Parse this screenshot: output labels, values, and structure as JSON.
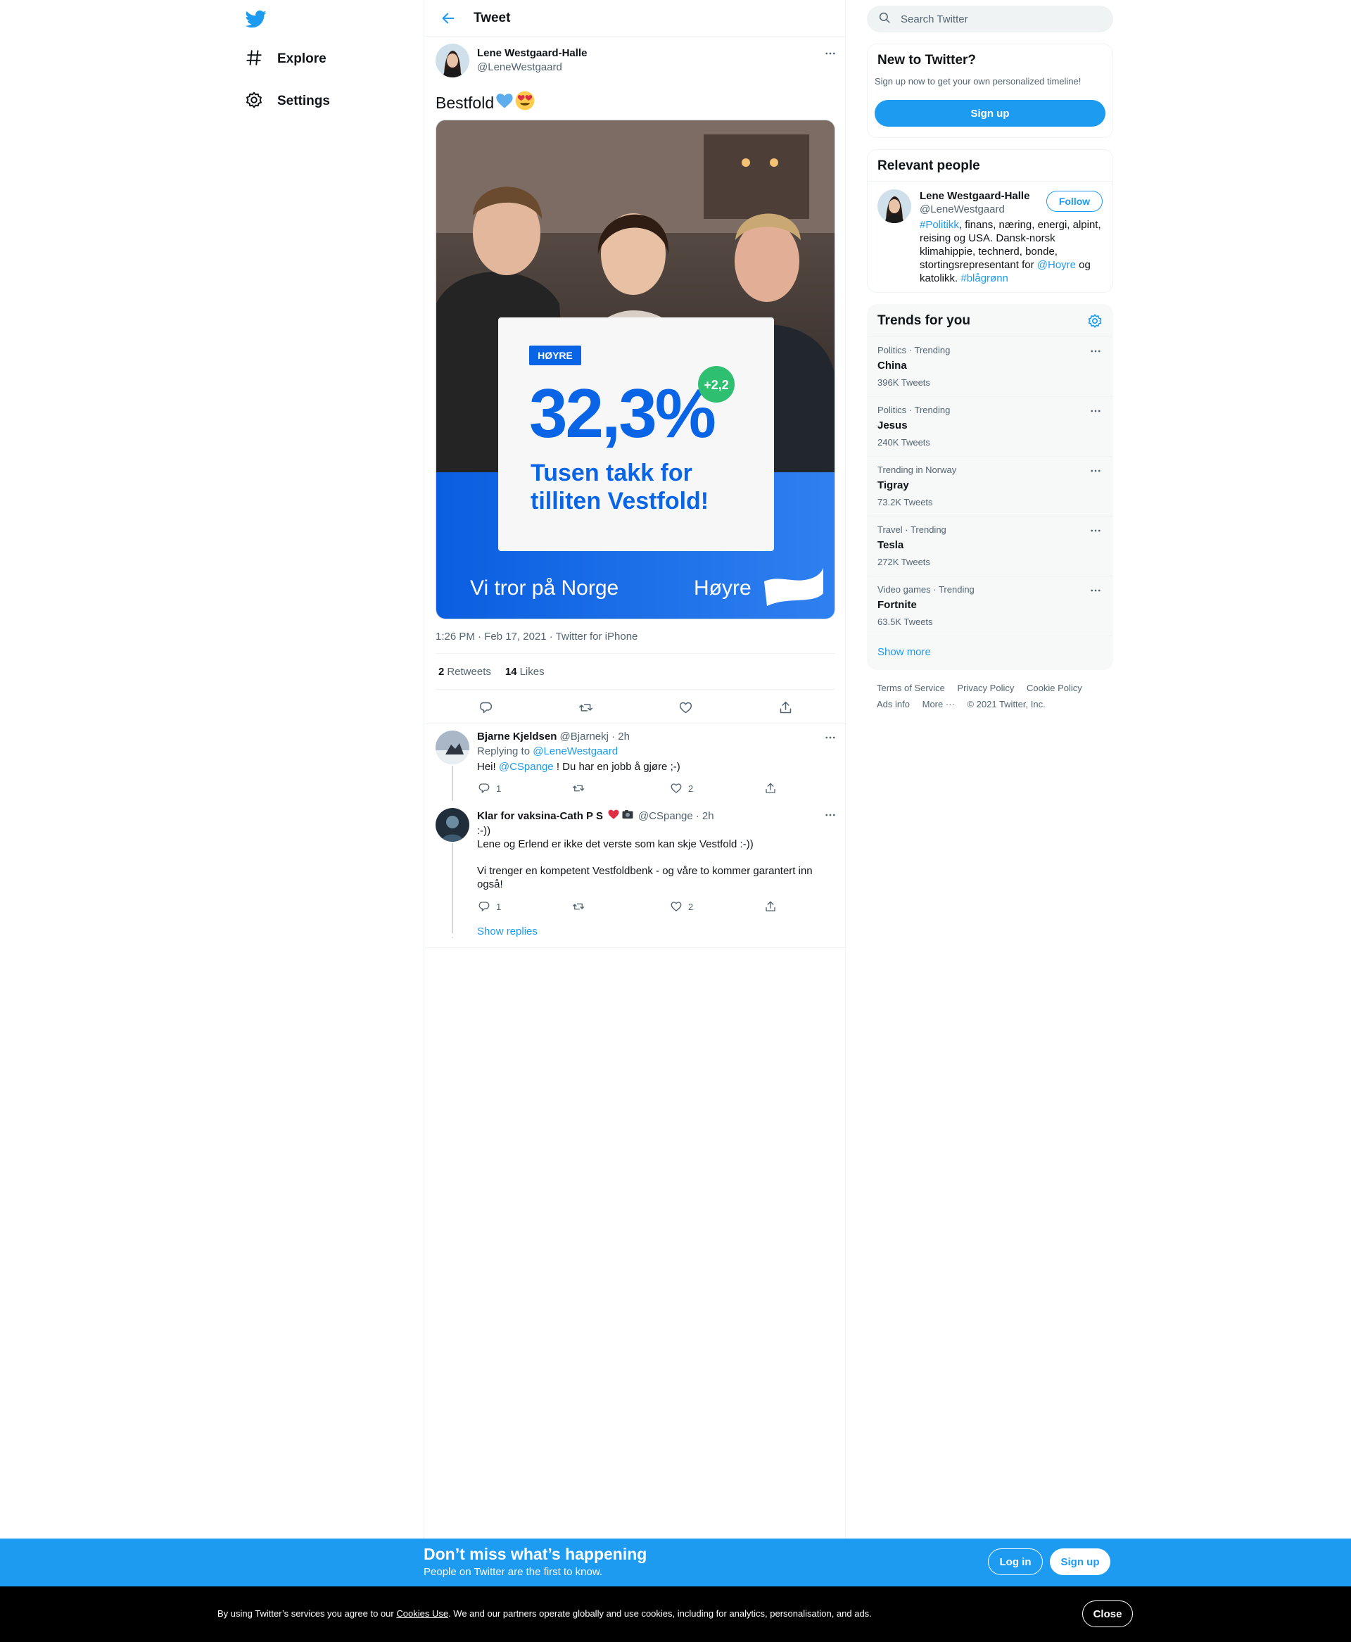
{
  "nav": {
    "items": [
      {
        "label": "Explore",
        "icon": "hashtag-icon"
      },
      {
        "label": "Settings",
        "icon": "gear-icon"
      }
    ]
  },
  "header": {
    "title": "Tweet"
  },
  "tweet": {
    "author_name": "Lene Westgaard-Halle",
    "author_handle": "@LeneWestgaard",
    "text": "Bestfold",
    "emojis": [
      "blue-heart-icon",
      "heart-eyes-icon"
    ],
    "image": {
      "badge": "HØYRE",
      "percent": "32,3%",
      "change": "+2,2",
      "thanks_line1": "Tusen takk for",
      "thanks_line2": "tilliten Vestfold!",
      "slogan": "Vi tror på Norge",
      "party": "Høyre"
    },
    "timestamp": "1:26 PM · Feb 17, 2021 · Twitter for iPhone",
    "retweets_count": "2",
    "retweets_label": "Retweets",
    "likes_count": "14",
    "likes_label": "Likes"
  },
  "replies": [
    {
      "name": "Bjarne Kjeldsen",
      "handle": "@Bjarnekj",
      "time": "· 2h",
      "replying_prefix": "Replying to",
      "replying_to": "@LeneWestgaard",
      "body_prefix": "Hei!",
      "body_mention": "@CSpange",
      "body_suffix": "! Du har en jobb å gjøre ;-)",
      "reply_count": "1",
      "like_count": "2"
    },
    {
      "name": "Klar for vaksina-Cath P S",
      "handle": "@CSpange",
      "time": "· 2h",
      "line1": ":-))",
      "line2": "Lene og Erlend er ikke det verste som kan skje Vestfold :-))",
      "line3": "Vi trenger en kompetent Vestfoldbenk - og våre to kommer garantert inn",
      "line4": "også!",
      "reply_count": "1",
      "like_count": "2"
    }
  ],
  "show_replies": "Show replies",
  "search": {
    "placeholder": "Search Twitter"
  },
  "new_to_twitter": {
    "title": "New to Twitter?",
    "subtitle": "Sign up now to get your own personalized timeline!",
    "button": "Sign up"
  },
  "relevant": {
    "title": "Relevant people",
    "name": "Lene Westgaard-Halle",
    "handle": "@LeneWestgaard",
    "follow": "Follow",
    "bio_tag1": "#Politikk",
    "bio_1": ", finans, næring, energi, alpint,",
    "bio_2": "reising og USA. Dansk-norsk",
    "bio_3": "klimahippie, technerd, bonde,",
    "bio_4a": "stortingsrepresentant for ",
    "bio_mention": "@Hoyre",
    "bio_4b": " og",
    "bio_5a": "katolikk. ",
    "bio_tag2": "#blågrønn"
  },
  "trends": {
    "title": "Trends for you",
    "items": [
      {
        "meta": "Politics · Trending",
        "name": "China",
        "count": "396K Tweets"
      },
      {
        "meta": "Politics · Trending",
        "name": "Jesus",
        "count": "240K Tweets"
      },
      {
        "meta": "Trending in Norway",
        "name": "Tigray",
        "count": "73.2K Tweets"
      },
      {
        "meta": "Travel · Trending",
        "name": "Tesla",
        "count": "272K Tweets"
      },
      {
        "meta": "Video games · Trending",
        "name": "Fortnite",
        "count": "63.5K Tweets"
      }
    ],
    "show_more": "Show more"
  },
  "footer": {
    "terms": "Terms of Service",
    "privacy": "Privacy Policy",
    "cookie": "Cookie Policy",
    "ads": "Ads info",
    "more": "More ···",
    "copyright": "© 2021 Twitter, Inc."
  },
  "signup_bar": {
    "title": "Don’t miss what’s happening",
    "subtitle": "People on Twitter are the first to know.",
    "login": "Log in",
    "signup": "Sign up"
  },
  "cookie_bar": {
    "prefix": "By using Twitter’s services you agree to our ",
    "link": "Cookies Use",
    "suffix": ". We and our partners operate globally and use cookies, including for analytics, personalisation, and ads.",
    "close": "Close"
  },
  "colors": {
    "accent": "#1d9bf0",
    "hoyre_blue": "#0a64e6",
    "green_badge": "#2fbf71"
  }
}
